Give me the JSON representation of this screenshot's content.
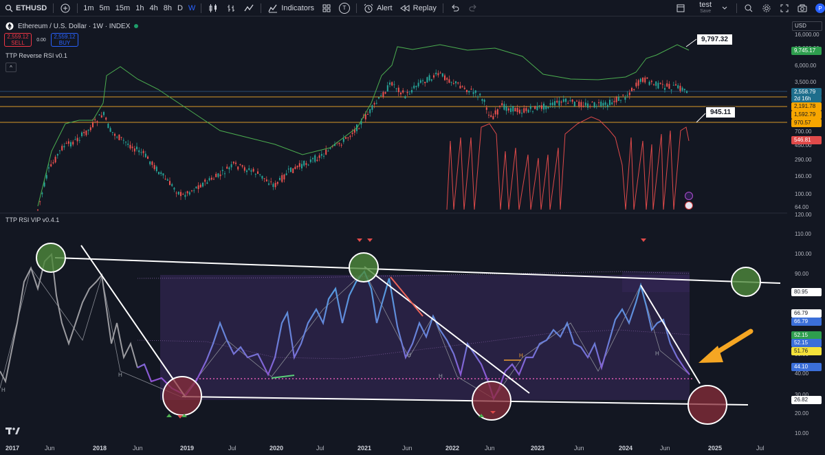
{
  "toolbar": {
    "symbol": "ETHUSD",
    "intervals": [
      "1m",
      "5m",
      "15m",
      "1h",
      "4h",
      "8h",
      "D",
      "W"
    ],
    "active_interval": "W",
    "indicators_label": "Indicators",
    "templates_badge": "T",
    "alert_label": "Alert",
    "replay_label": "Replay",
    "user_name": "test",
    "user_status": "Save",
    "avatar_letter": "P"
  },
  "legend": {
    "title": "Ethereum / U.S. Dollar · 1W · INDEX",
    "sell_price": "2,559.12",
    "sell_label": "SELL",
    "spread": "0.00",
    "buy_price": "2,559.12",
    "buy_label": "BUY"
  },
  "indicators": {
    "upper": "TTP Reverse RSI v0.1",
    "collapse_icon": "^",
    "lower": "TTP RSI VIP v0.4.1"
  },
  "currency_selector": "USD",
  "price_axis_ticks": [
    "16,000.00",
    "10,000.00",
    "6,000.00",
    "3,500.00",
    "2,000.00",
    "1,200.00",
    "700.00",
    "450.00",
    "290.00",
    "160.00",
    "100.00",
    "64.00"
  ],
  "price_labels": {
    "green_top": "9,745.17",
    "current": "2,558.79",
    "countdown": "2d 16h",
    "orange_1": "2,191.78",
    "orange_2": "1,592.79",
    "orange_3": "970.57",
    "red": "546.81"
  },
  "callouts": {
    "upper": "9,797.32",
    "lower": "945.11"
  },
  "rsi_axis_ticks": [
    "120.00",
    "110.00",
    "100.00",
    "90.00",
    "70.00",
    "60.00",
    "50.00",
    "40.00",
    "30.00",
    "20.00",
    "10.00"
  ],
  "rsi_labels": {
    "white_top": "80.95",
    "blue_1": "66.79",
    "blue_2": "66.79",
    "green": "52.15",
    "blue_3": "52.15",
    "yellow": "51.76",
    "blue_4": "44.10",
    "white_bottom": "26.82"
  },
  "time_axis": [
    {
      "label": "2017",
      "bold": true
    },
    {
      "label": "Jun",
      "bold": false
    },
    {
      "label": "2018",
      "bold": true
    },
    {
      "label": "Jun",
      "bold": false
    },
    {
      "label": "2019",
      "bold": true
    },
    {
      "label": "Jul",
      "bold": false
    },
    {
      "label": "2020",
      "bold": true
    },
    {
      "label": "Jul",
      "bold": false
    },
    {
      "label": "2021",
      "bold": true
    },
    {
      "label": "Jun",
      "bold": false
    },
    {
      "label": "2022",
      "bold": true
    },
    {
      "label": "Jun",
      "bold": false
    },
    {
      "label": "2023",
      "bold": true
    },
    {
      "label": "Jun",
      "bold": false
    },
    {
      "label": "2024",
      "bold": true
    },
    {
      "label": "Jun",
      "bold": false
    },
    {
      "label": "2025",
      "bold": true
    },
    {
      "label": "Jul",
      "bold": false
    }
  ],
  "pivot_letters": [
    "H",
    "H",
    "H",
    "H",
    "H",
    "H"
  ],
  "logo_text": "17",
  "colors": {
    "background": "#131722",
    "accent_blue": "#2962ff",
    "green_line": "#4caf50",
    "red_line": "#f23645",
    "orange_level": "#f7a600",
    "rsi_blue": "#5aa9e6",
    "rsi_purple": "#9c4dcc",
    "arrow_orange": "#f5a623"
  }
}
